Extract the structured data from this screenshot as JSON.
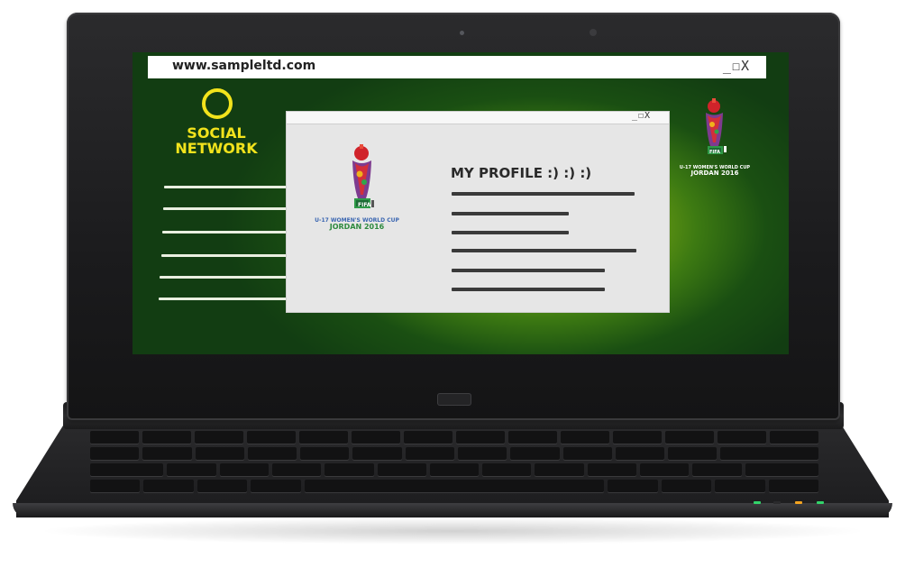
{
  "browser": {
    "url": "www.sampleltd.com",
    "window_controls": "_☐X"
  },
  "social_network": {
    "title_line1": "SOCIAL",
    "title_line2": "NETWORK",
    "brand_color": "#f2e31c",
    "nav_items": 6
  },
  "profile_window": {
    "window_controls": "_☐X",
    "title": "MY PROFILE :) :) :)"
  },
  "fifa_logo": {
    "badge": "FIFA",
    "caption_line1": "U-17 WOMEN'S WORLD CUP",
    "caption_line2": "JORDAN 2016"
  },
  "colors": {
    "screen_green": "#3d7a12",
    "screen_highlight": "#b9d11a",
    "led_green": "#32d46a",
    "led_amber": "#f3a320"
  }
}
